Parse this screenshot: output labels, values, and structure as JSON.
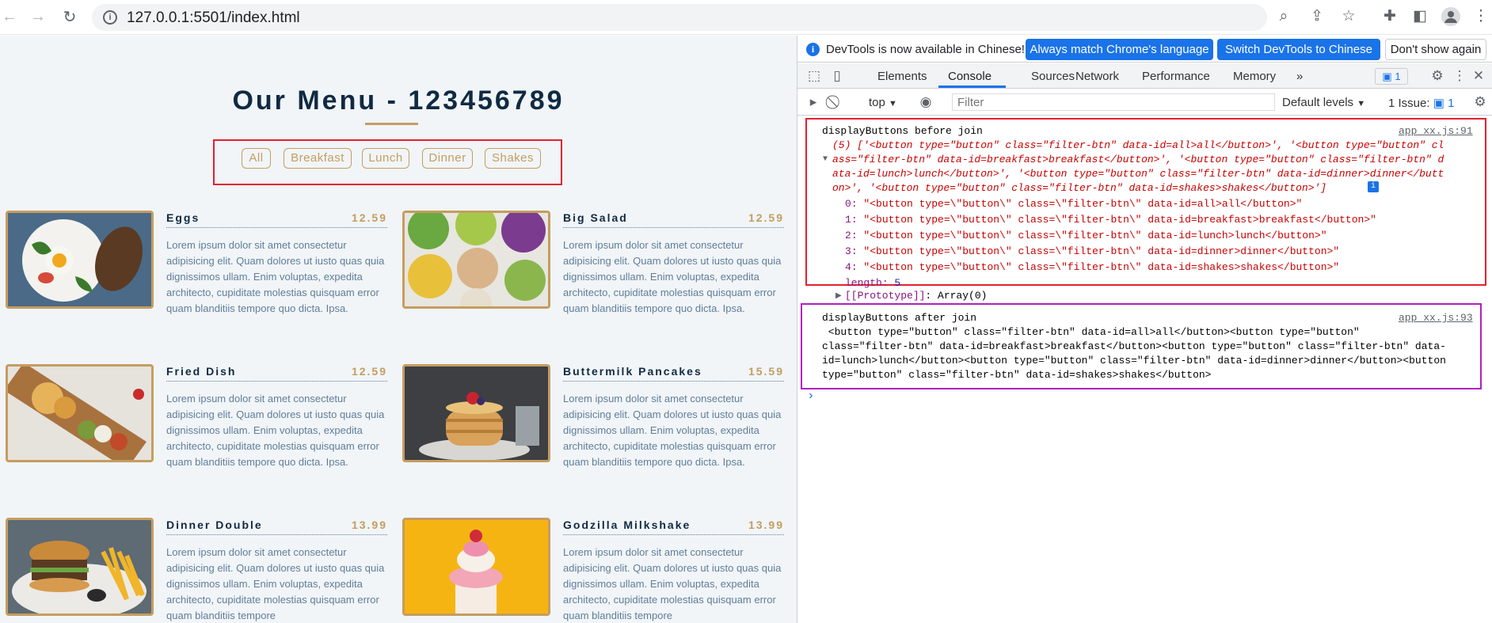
{
  "browser": {
    "url": "127.0.0.1:5501/index.html",
    "back_icon": "arrow-left-icon",
    "forward_icon": "arrow-right-icon",
    "reload_icon": "reload-icon",
    "site_info_icon": "info-icon",
    "zoom_icon": "zoom-icon",
    "share_icon": "share-icon",
    "bookmark_icon": "star-icon",
    "extensions_icon": "puzzle-icon",
    "sidepanel_icon": "side-panel-icon",
    "profile_icon": "avatar-icon",
    "menu_icon": "kebab-menu-icon"
  },
  "page": {
    "title": "Our Menu - 123456789",
    "filters": [
      "All",
      "Breakfast",
      "Lunch",
      "Dinner",
      "Shakes"
    ],
    "items": [
      {
        "name": "Eggs",
        "price": "12.59",
        "desc": "Lorem ipsum dolor sit amet consectetur adipisicing elit. Quam dolores ut iusto quas quia dignissimos ullam. Enim voluptas, expedita architecto, cupiditate molestias quisquam error quam blanditiis tempore quo dicta. Ipsa."
      },
      {
        "name": "Big Salad",
        "price": "12.59",
        "desc": "Lorem ipsum dolor sit amet consectetur adipisicing elit. Quam dolores ut iusto quas quia dignissimos ullam. Enim voluptas, expedita architecto, cupiditate molestias quisquam error quam blanditiis tempore quo dicta. Ipsa."
      },
      {
        "name": "Fried Dish",
        "price": "12.59",
        "desc": "Lorem ipsum dolor sit amet consectetur adipisicing elit. Quam dolores ut iusto quas quia dignissimos ullam. Enim voluptas, expedita architecto, cupiditate molestias quisquam error quam blanditiis tempore quo dicta. Ipsa."
      },
      {
        "name": "Buttermilk Pancakes",
        "price": "15.59",
        "desc": "Lorem ipsum dolor sit amet consectetur adipisicing elit. Quam dolores ut iusto quas quia dignissimos ullam. Enim voluptas, expedita architecto, cupiditate molestias quisquam error quam blanditiis tempore quo dicta. Ipsa."
      },
      {
        "name": "Dinner Double",
        "price": "13.99",
        "desc": "Lorem ipsum dolor sit amet consectetur adipisicing elit. Quam dolores ut iusto quas quia dignissimos ullam. Enim voluptas, expedita architecto, cupiditate molestias quisquam error quam blanditiis tempore"
      },
      {
        "name": "Godzilla Milkshake",
        "price": "13.99",
        "desc": "Lorem ipsum dolor sit amet consectetur adipisicing elit. Quam dolores ut iusto quas quia dignissimos ullam. Enim voluptas, expedita architecto, cupiditate molestias quisquam error quam blanditiis tempore"
      }
    ]
  },
  "devtools": {
    "banner": {
      "message": "DevTools is now available in Chinese!",
      "match_button": "Always match Chrome's language",
      "switch_button": "Switch DevTools to Chinese",
      "dismiss_button": "Don't show again"
    },
    "tabs": [
      "Elements",
      "Console",
      "Sources",
      "Network",
      "Performance",
      "Memory"
    ],
    "active_tab": "Console",
    "more_tabs": "»",
    "issues_badge": "1",
    "console_bar": {
      "context": "top",
      "filter_placeholder": "Filter",
      "levels": "Default levels",
      "issues": "1 Issue:",
      "issues_count": "1"
    },
    "log1": {
      "label": "displayButtons before join",
      "source": "app_xx.js:91",
      "summary": [
        "(5) ['<button type=\"button\" class=\"filter-btn\" data-id=all>all</button>', '<button type=\"button\" cl",
        "ass=\"filter-btn\" data-id=breakfast>breakfast</button>', '<button type=\"button\" class=\"filter-btn\" d",
        "ata-id=lunch>lunch</button>', '<button type=\"button\" class=\"filter-btn\" data-id=dinner>dinner</butt",
        "on>', '<button type=\"button\" class=\"filter-btn\" data-id=shakes>shakes</button>']"
      ],
      "entries": [
        {
          "key": "0",
          "value": "\"<button type=\\\"button\\\" class=\\\"filter-btn\\\" data-id=all>all</button>\""
        },
        {
          "key": "1",
          "value": "\"<button type=\\\"button\\\" class=\\\"filter-btn\\\" data-id=breakfast>breakfast</button>\""
        },
        {
          "key": "2",
          "value": "\"<button type=\\\"button\\\" class=\\\"filter-btn\\\" data-id=lunch>lunch</button>\""
        },
        {
          "key": "3",
          "value": "\"<button type=\\\"button\\\" class=\\\"filter-btn\\\" data-id=dinner>dinner</button>\""
        },
        {
          "key": "4",
          "value": "\"<button type=\\\"button\\\" class=\\\"filter-btn\\\" data-id=shakes>shakes</button>\""
        }
      ],
      "length_key": "length",
      "length_value": "5",
      "prototype_key": "[[Prototype]]",
      "prototype_value": "Array(0)"
    },
    "log2": {
      "label": "displayButtons after join",
      "source": "app_xx.js:93",
      "lines": [
        " <button type=\"button\" class=\"filter-btn\" data-id=all>all</button><button type=\"button\"",
        "class=\"filter-btn\" data-id=breakfast>breakfast</button><button type=\"button\" class=\"filter-btn\" data-",
        "id=lunch>lunch</button><button type=\"button\" class=\"filter-btn\" data-id=dinner>dinner</button><button",
        "type=\"button\" class=\"filter-btn\" data-id=shakes>shakes</button>"
      ]
    },
    "prompt": "›"
  },
  "colors": {
    "accent": "#c59d5f",
    "heading": "#102a42",
    "body_text": "#617d98",
    "page_bg": "#f1f5f8",
    "highlight_red": "#e3212e",
    "highlight_magenta": "#b31ec0",
    "devtools_blue": "#1a73e8"
  }
}
